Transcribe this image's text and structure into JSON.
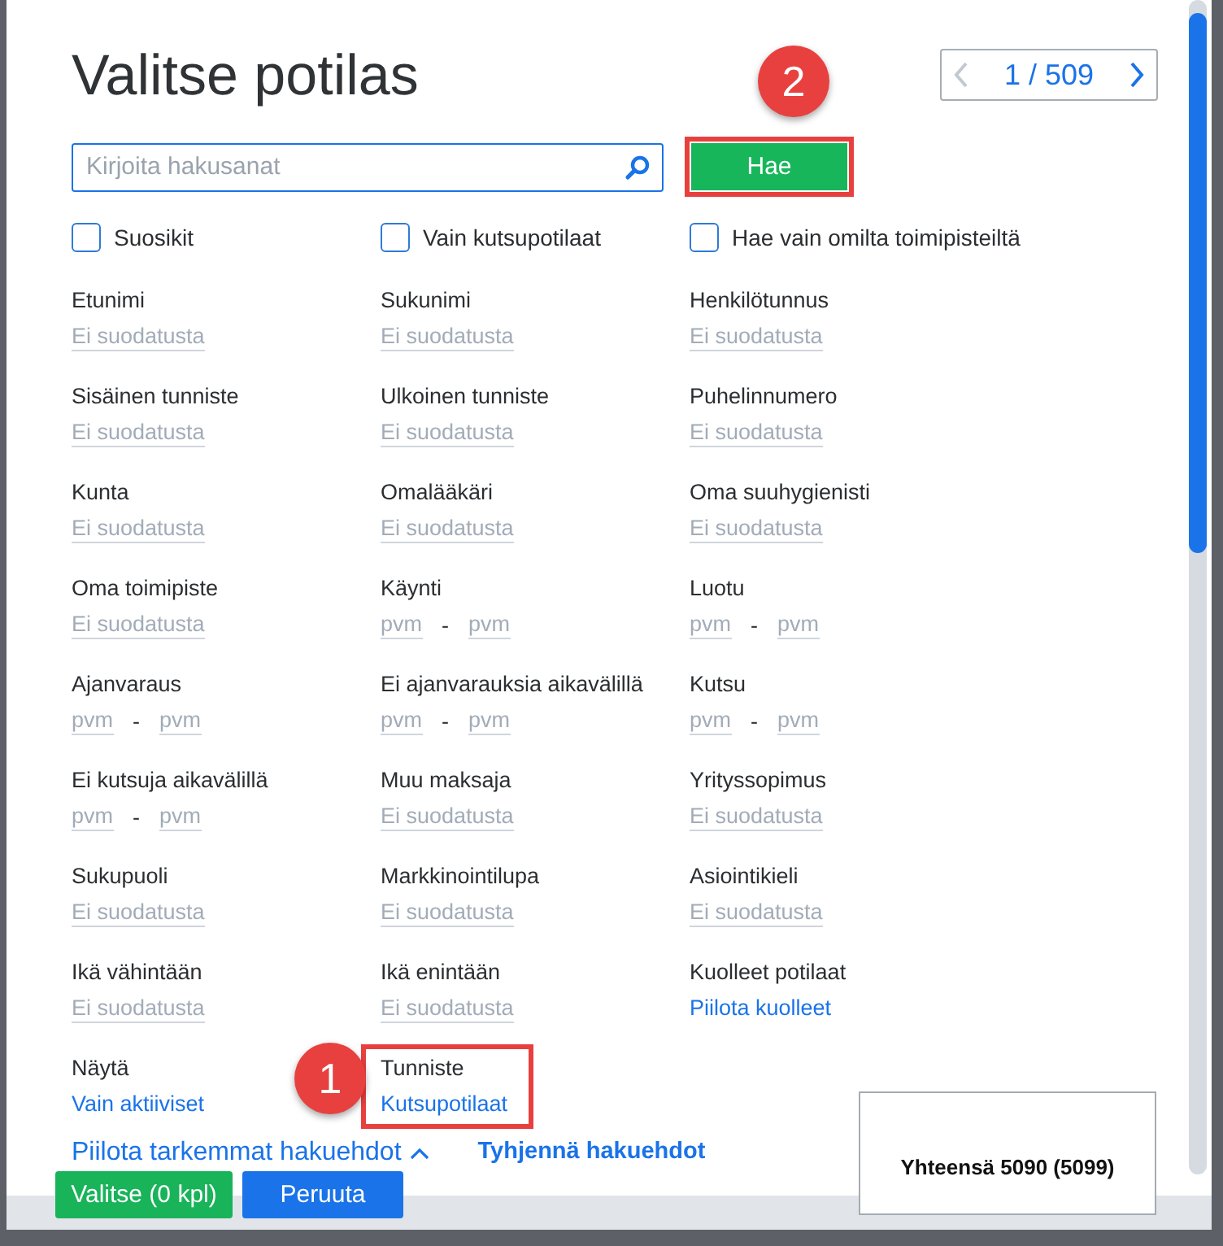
{
  "dialog": {
    "title": "Valitse potilas"
  },
  "pager": {
    "text": "1 / 509",
    "prev_disabled": true,
    "next_disabled": false
  },
  "search": {
    "placeholder": "Kirjoita hakusanat",
    "button": {
      "label": "Hae",
      "highlighted": true,
      "badge": "2"
    }
  },
  "checkboxes": [
    {
      "label": "Suosikit",
      "checked": false
    },
    {
      "label": "Vain kutsupotilaat",
      "checked": false
    },
    {
      "label": "Hae vain omilta toimipisteiltä",
      "checked": false
    }
  ],
  "filters": [
    {
      "label": "Etunimi",
      "kind": "filter",
      "value": "Ei suodatusta",
      "highlighted": false
    },
    {
      "label": "Sukunimi",
      "kind": "filter",
      "value": "Ei suodatusta",
      "highlighted": false
    },
    {
      "label": "Henkilötunnus",
      "kind": "filter",
      "value": "Ei suodatusta",
      "highlighted": false
    },
    {
      "label": "Sisäinen tunniste",
      "kind": "filter",
      "value": "Ei suodatusta",
      "highlighted": false
    },
    {
      "label": "Ulkoinen tunniste",
      "kind": "filter",
      "value": "Ei suodatusta",
      "highlighted": false
    },
    {
      "label": "Puhelinnumero",
      "kind": "filter",
      "value": "Ei suodatusta",
      "highlighted": false
    },
    {
      "label": "Kunta",
      "kind": "filter",
      "value": "Ei suodatusta",
      "highlighted": false
    },
    {
      "label": "Omalääkäri",
      "kind": "filter",
      "value": "Ei suodatusta",
      "highlighted": false
    },
    {
      "label": "Oma suuhygienisti",
      "kind": "filter",
      "value": "Ei suodatusta",
      "highlighted": false
    },
    {
      "label": "Oma toimipiste",
      "kind": "filter",
      "value": "Ei suodatusta",
      "highlighted": false
    },
    {
      "label": "Käynti",
      "kind": "date_range",
      "from": "pvm",
      "separator": "-",
      "to": "pvm",
      "highlighted": false
    },
    {
      "label": "Luotu",
      "kind": "date_range",
      "from": "pvm",
      "separator": "-",
      "to": "pvm",
      "highlighted": false
    },
    {
      "label": "Ajanvaraus",
      "kind": "date_range",
      "from": "pvm",
      "separator": "-",
      "to": "pvm",
      "highlighted": false
    },
    {
      "label": "Ei ajanvarauksia aikavälillä",
      "kind": "date_range",
      "from": "pvm",
      "separator": "-",
      "to": "pvm",
      "highlighted": false
    },
    {
      "label": "Kutsu",
      "kind": "date_range",
      "from": "pvm",
      "separator": "-",
      "to": "pvm",
      "highlighted": false
    },
    {
      "label": "Ei kutsuja aikavälillä",
      "kind": "date_range",
      "from": "pvm",
      "separator": "-",
      "to": "pvm",
      "highlighted": false
    },
    {
      "label": "Muu maksaja",
      "kind": "filter",
      "value": "Ei suodatusta",
      "highlighted": false
    },
    {
      "label": "Yrityssopimus",
      "kind": "filter",
      "value": "Ei suodatusta",
      "highlighted": false
    },
    {
      "label": "Sukupuoli",
      "kind": "filter",
      "value": "Ei suodatusta",
      "highlighted": false
    },
    {
      "label": "Markkinointilupa",
      "kind": "filter",
      "value": "Ei suodatusta",
      "highlighted": false
    },
    {
      "label": "Asiointikieli",
      "kind": "filter",
      "value": "Ei suodatusta",
      "highlighted": false
    },
    {
      "label": "Ikä vähintään",
      "kind": "filter",
      "value": "Ei suodatusta",
      "highlighted": false
    },
    {
      "label": "Ikä enintään",
      "kind": "filter",
      "value": "Ei suodatusta",
      "highlighted": false
    },
    {
      "label": "Kuolleet potilaat",
      "kind": "link",
      "value": "Piilota kuolleet",
      "highlighted": false
    },
    {
      "label": "Näytä",
      "kind": "link",
      "value": "Vain aktiiviset",
      "highlighted": false
    },
    {
      "label": "Tunniste",
      "kind": "link",
      "value": "Kutsupotilaat",
      "highlighted": true,
      "badge": "1"
    }
  ],
  "links": [
    {
      "label": "Piilota tarkemmat hakuehdot",
      "kind": "collapse"
    },
    {
      "label": "Tyhjennä hakuehdot",
      "kind": "clear"
    }
  ],
  "footer_buttons": [
    {
      "label": "Valitse (0 kpl)",
      "kind": "primary"
    },
    {
      "label": "Peruuta",
      "kind": "secondary"
    }
  ],
  "result": {
    "text": "Yhteensä 5090 (5099)"
  }
}
